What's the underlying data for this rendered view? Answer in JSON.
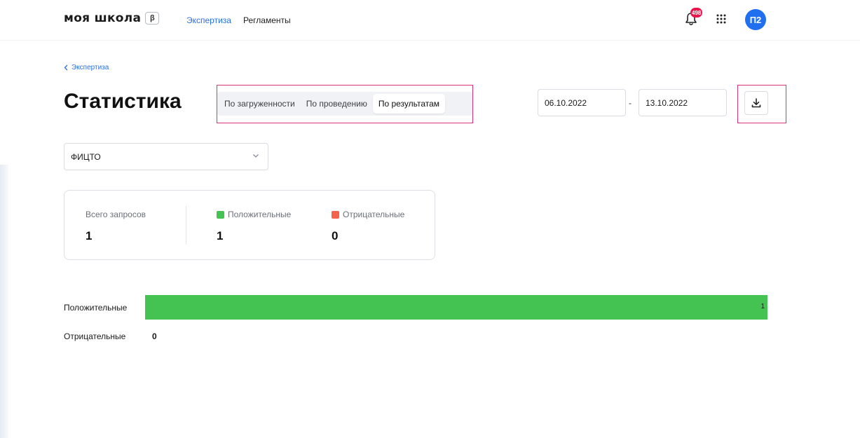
{
  "header": {
    "logo": "моя школа",
    "beta": "β",
    "nav": [
      {
        "label": "Экспертиза",
        "active": true
      },
      {
        "label": "Регламенты",
        "active": false
      }
    ],
    "notifications_count": "498",
    "notifications_icon": "bell-icon",
    "apps_icon": "grid-icon",
    "avatar_initials": "П2",
    "avatar_color": "#1f6ff0"
  },
  "breadcrumb": {
    "back_icon": "chevron-left-icon",
    "label": "Экспертиза"
  },
  "page_title": "Статистика",
  "tabs": [
    {
      "label": "По загруженности",
      "active": false
    },
    {
      "label": "По проведению",
      "active": false
    },
    {
      "label": "По результатам",
      "active": true
    }
  ],
  "date_range": {
    "from": "06.10.2022",
    "separator": "-",
    "to": "13.10.2022"
  },
  "download_icon": "download-icon",
  "select": {
    "value": "ФИЦТО",
    "icon": "chevron-down-icon"
  },
  "stats": {
    "total": {
      "label": "Всего запросов",
      "value": "1"
    },
    "positive": {
      "label": "Положительные",
      "value": "1",
      "color": "#44c252"
    },
    "negative": {
      "label": "Отрицательные",
      "value": "0",
      "color": "#f4634b"
    }
  },
  "results": {
    "max": 1,
    "rows": [
      {
        "label": "Положительные",
        "value": 1,
        "value_text": "1",
        "color": "#44c252"
      },
      {
        "label": "Отрицательные",
        "value": 0,
        "value_text": "0",
        "color": "#f4634b"
      }
    ]
  }
}
